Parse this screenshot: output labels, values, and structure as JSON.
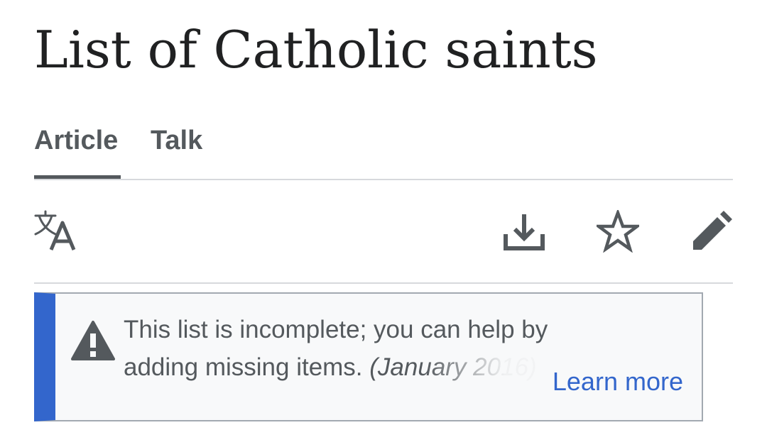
{
  "page": {
    "title": "List of Catholic saints"
  },
  "tabs": [
    {
      "label": "Article",
      "selected": true
    },
    {
      "label": "Talk",
      "selected": false
    }
  ],
  "toolbar": {
    "language_icon": "language-translate-icon",
    "download_icon": "download-icon",
    "watch_icon": "star-icon",
    "edit_icon": "pencil-icon"
  },
  "notice": {
    "icon": "warning-icon",
    "text": "This list is incomplete; you can help by adding missing items.",
    "date": "(January 2016)",
    "learn_more": "Learn more"
  },
  "colors": {
    "accent": "#3366cc",
    "icon": "#54595d",
    "divider": "#d7d9dc",
    "notice_background": "#f8f9fa",
    "notice_border": "#a2a9b1"
  }
}
